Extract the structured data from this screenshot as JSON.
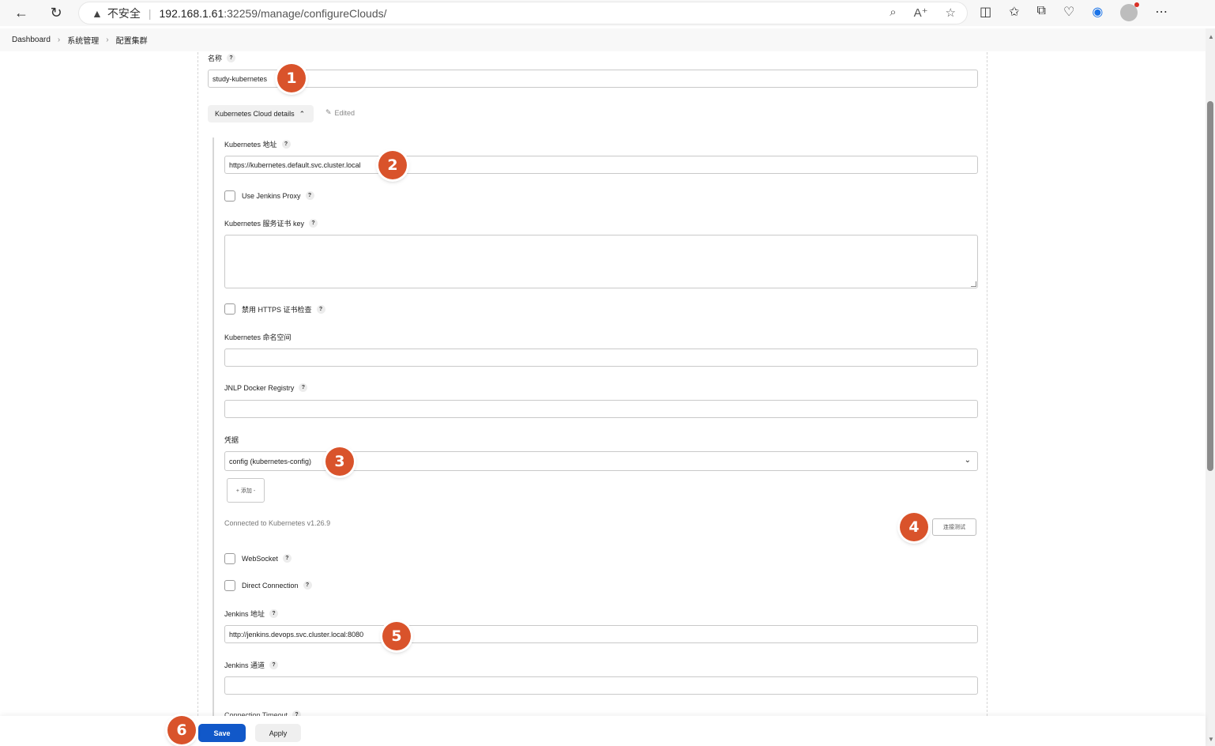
{
  "browser": {
    "security_warning": "不安全",
    "url_host": "192.168.1.61",
    "url_rest": ":32259/manage/configureClouds/"
  },
  "breadcrumb": [
    "Dashboard",
    "系统管理",
    "配置集群"
  ],
  "form": {
    "name_label": "名称",
    "name_value": "study-kubernetes",
    "section_title": "Kubernetes Cloud details",
    "edited_label": "Edited",
    "k8s_url_label": "Kubernetes 地址",
    "k8s_url_value": "https://kubernetes.default.svc.cluster.local",
    "use_proxy_label": "Use Jenkins Proxy",
    "cert_key_label": "Kubernetes 服务证书 key",
    "disable_https_label": "禁用 HTTPS 证书检查",
    "namespace_label": "Kubernetes 命名空间",
    "jnlp_label": "JNLP Docker Registry",
    "credentials_label": "凭据",
    "credentials_value": "config (kubernetes-config)",
    "add_button": "+ 添加 -",
    "connection_status": "Connected to Kubernetes v1.26.9",
    "test_button": "连接测试",
    "websocket_label": "WebSocket",
    "direct_connection_label": "Direct Connection",
    "jenkins_url_label": "Jenkins 地址",
    "jenkins_url_value": "http://jenkins.devops.svc.cluster.local:8080",
    "jenkins_tunnel_label": "Jenkins 通道",
    "connection_timeout_label": "Connection Timeout"
  },
  "actions": {
    "save": "Save",
    "apply": "Apply"
  },
  "markers": [
    "1",
    "2",
    "3",
    "4",
    "5",
    "6"
  ],
  "colors": {
    "primary": "#1158c9",
    "marker": "#d9532b"
  }
}
